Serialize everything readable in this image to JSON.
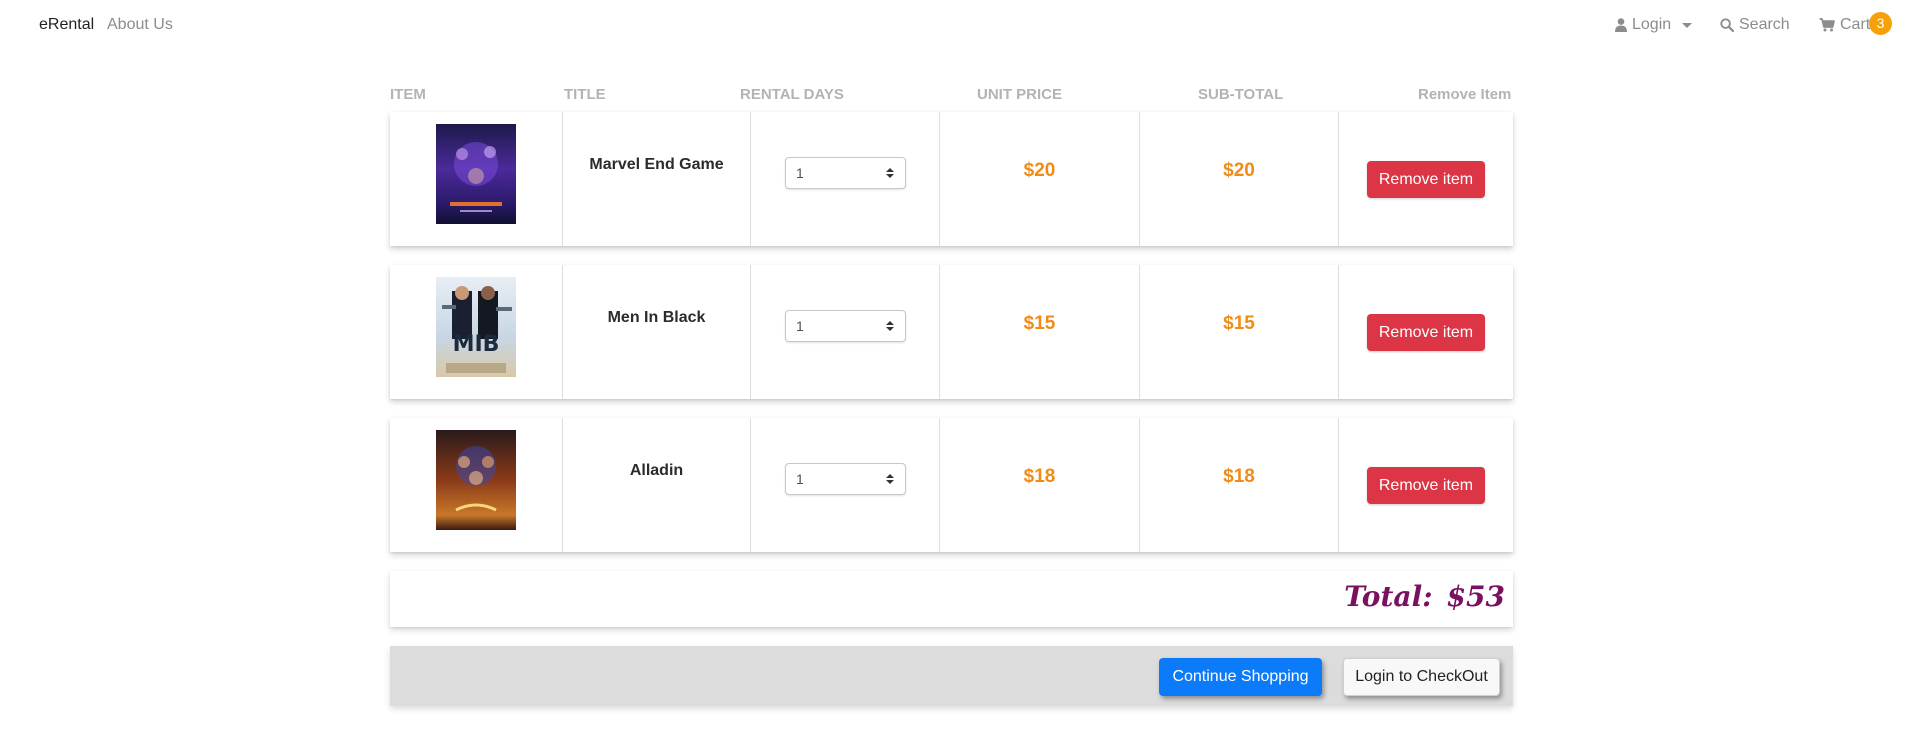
{
  "nav": {
    "brand": "eRental",
    "about": "About Us",
    "login": "Login",
    "search": "Search",
    "cart": "Cart",
    "cart_count": "3"
  },
  "table": {
    "headers": {
      "item": "ITEM",
      "title": "TITLE",
      "days": "RENTAL DAYS",
      "unit": "UNIT PRICE",
      "sub": "SUB-TOTAL",
      "remove": "Remove Item"
    },
    "rows": [
      {
        "title": "Marvel End Game",
        "days": "1",
        "unit_price": "$20",
        "subtotal": "$20",
        "remove_label": "Remove item"
      },
      {
        "title": "Men In Black",
        "days": "1",
        "unit_price": "$15",
        "subtotal": "$15",
        "remove_label": "Remove item"
      },
      {
        "title": "Alladin",
        "days": "1",
        "unit_price": "$18",
        "subtotal": "$18",
        "remove_label": "Remove item"
      }
    ]
  },
  "total": {
    "label": "Total:",
    "value": "$53"
  },
  "actions": {
    "continue": "Continue Shopping",
    "checkout": "Login to CheckOut"
  },
  "colors": {
    "price": "#f08c16",
    "remove_button": "#dc3545",
    "total": "#7a1060",
    "continue_button": "#0b7bfa",
    "badge": "#f6a10a"
  },
  "icons": {
    "login": "user-icon",
    "search": "search-icon",
    "cart": "cart-icon"
  }
}
